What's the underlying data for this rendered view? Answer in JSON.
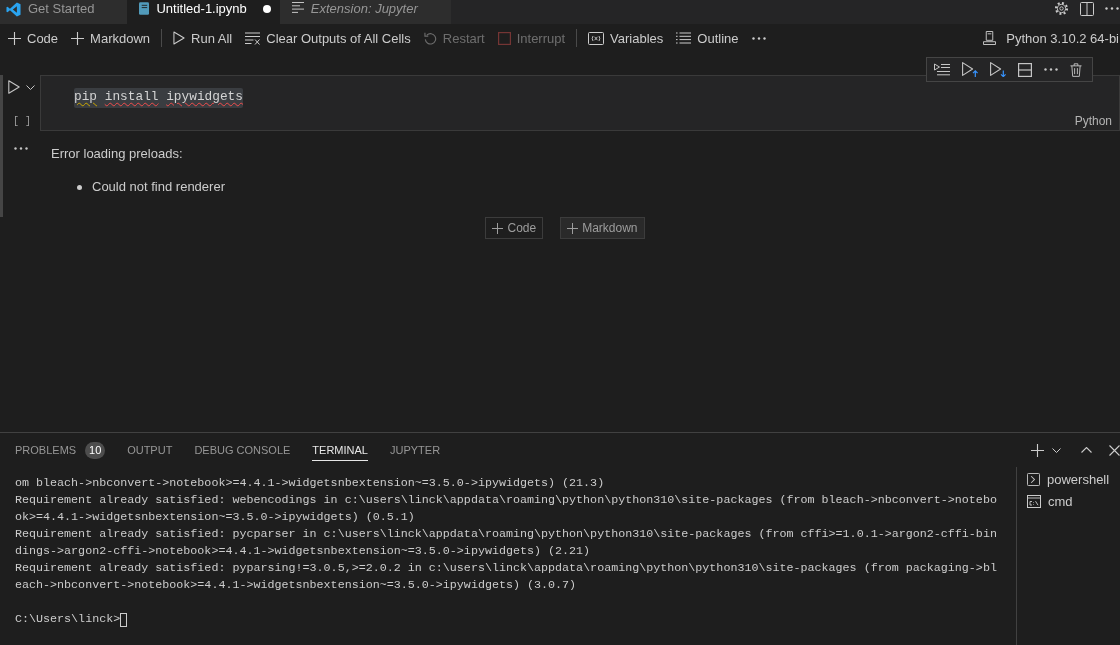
{
  "editor_tabs": [
    {
      "label": "Get Started",
      "kind": "welcome",
      "selected": false,
      "modified": false
    },
    {
      "label": "Untitled-1.ipynb",
      "kind": "notebook",
      "selected": true,
      "modified": true
    },
    {
      "label": "Extension: Jupyter",
      "kind": "preview",
      "selected": false,
      "modified": false
    }
  ],
  "toolbar": {
    "items": [
      {
        "kind": "add",
        "label": "Code",
        "disabled": false
      },
      {
        "kind": "add",
        "label": "Markdown",
        "disabled": false
      },
      {
        "kind": "separator"
      },
      {
        "kind": "run",
        "label": "Run All",
        "disabled": false
      },
      {
        "kind": "clear",
        "label": "Clear Outputs of All Cells",
        "disabled": false
      },
      {
        "kind": "restart",
        "label": "Restart",
        "disabled": true
      },
      {
        "kind": "interrupt",
        "label": "Interrupt",
        "disabled": true
      },
      {
        "kind": "separator"
      },
      {
        "kind": "variables",
        "label": "Variables",
        "disabled": false
      },
      {
        "kind": "outline",
        "label": "Outline",
        "disabled": false
      },
      {
        "kind": "more",
        "disabled": false
      }
    ]
  },
  "kernel": {
    "label": "Python 3.10.2 64-bi"
  },
  "cell": {
    "execution_label": "[ ]",
    "code": {
      "selected": true,
      "tokens": [
        {
          "text": "pip",
          "kind": "warning"
        },
        {
          "text": "install",
          "kind": "error"
        },
        {
          "text": "ipywidgets",
          "kind": "error"
        }
      ]
    },
    "language": "Python",
    "output": {
      "title": "Error loading preloads:",
      "items": [
        "Could not find renderer"
      ]
    }
  },
  "add_cell_buttons": [
    {
      "label": "Code",
      "hovered": false
    },
    {
      "label": "Markdown",
      "hovered": true
    }
  ],
  "panel": {
    "tabs": [
      {
        "label": "PROBLEMS",
        "badge": "10",
        "selected": false
      },
      {
        "label": "OUTPUT",
        "selected": false
      },
      {
        "label": "DEBUG CONSOLE",
        "selected": false
      },
      {
        "label": "TERMINAL",
        "selected": true
      },
      {
        "label": "JUPYTER",
        "selected": false
      }
    ],
    "terminal": {
      "lines": [
        "om bleach->nbconvert->notebook>=4.4.1->widgetsnbextension~=3.5.0->ipywidgets) (21.3)",
        "Requirement already satisfied: webencodings in c:\\users\\linck\\appdata\\roaming\\python\\python310\\site-packages (from bleach->nbconvert->notebo",
        "ok>=4.4.1->widgetsnbextension~=3.5.0->ipywidgets) (0.5.1)",
        "Requirement already satisfied: pycparser in c:\\users\\linck\\appdata\\roaming\\python\\python310\\site-packages (from cffi>=1.0.1->argon2-cffi-bin",
        "dings->argon2-cffi->notebook>=4.4.1->widgetsnbextension~=3.5.0->ipywidgets) (2.21)",
        "Requirement already satisfied: pyparsing!=3.0.5,>=2.0.2 in c:\\users\\linck\\appdata\\roaming\\python\\python310\\site-packages (from packaging->bl",
        "each->nbconvert->notebook>=4.4.1->widgetsnbextension~=3.5.0->ipywidgets) (3.0.7)"
      ],
      "prompt": "C:\\Users\\linck>"
    },
    "terminals": [
      {
        "kind": "powershell",
        "label": "powershell"
      },
      {
        "kind": "cmd",
        "label": "cmd"
      }
    ]
  }
}
